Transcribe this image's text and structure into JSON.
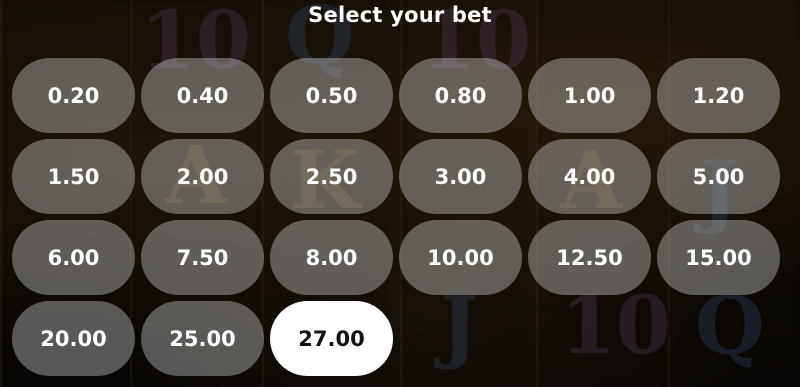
{
  "title": "Select your bet",
  "selected_bet": "27.00",
  "bets": [
    "0.20",
    "0.40",
    "0.50",
    "0.80",
    "1.00",
    "1.20",
    "1.50",
    "2.00",
    "2.50",
    "3.00",
    "4.00",
    "5.00",
    "6.00",
    "7.50",
    "8.00",
    "10.00",
    "12.50",
    "15.00",
    "20.00",
    "25.00",
    "27.00"
  ],
  "colors": {
    "button_bg": "#c8c8c8",
    "selected_bg": "#ffffff",
    "selected_text": "#111111",
    "text": "#ffffff"
  }
}
